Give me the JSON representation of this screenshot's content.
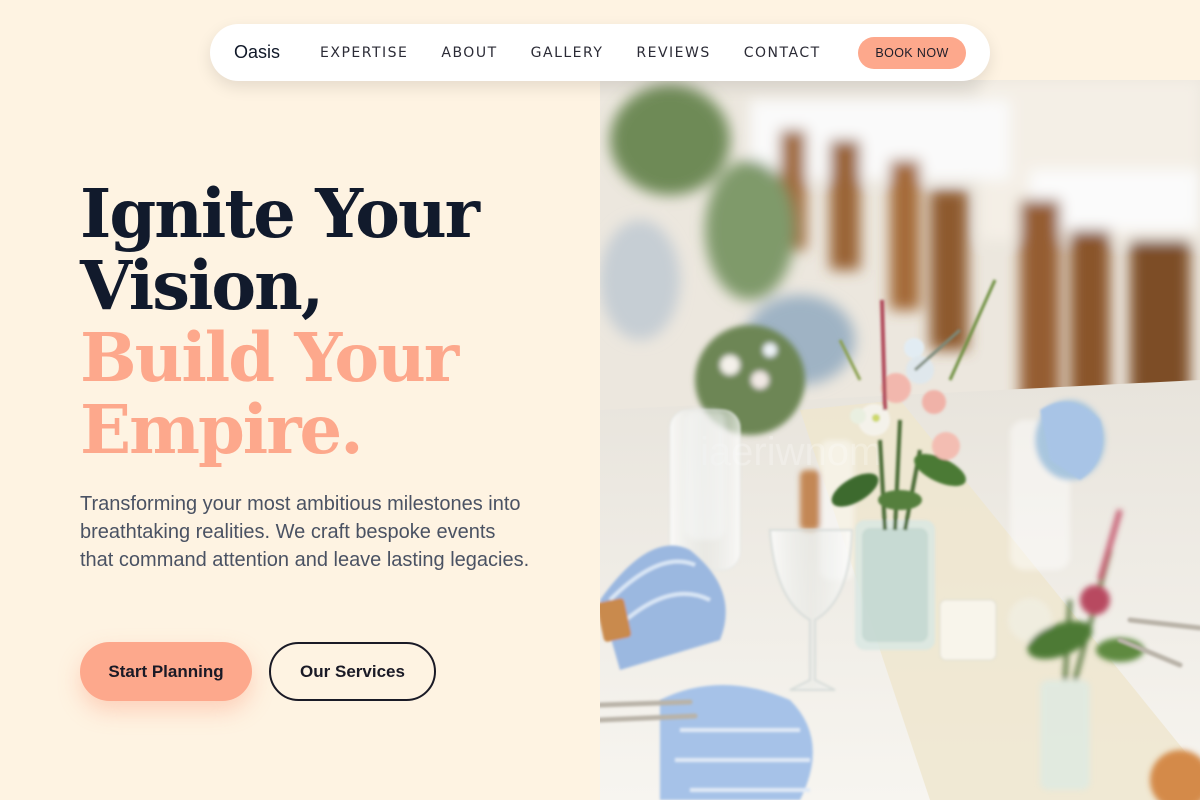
{
  "brand": {
    "name": "Oasis"
  },
  "nav": {
    "links": [
      "EXPERTISE",
      "ABOUT",
      "GALLERY",
      "REVIEWS",
      "CONTACT"
    ],
    "cta_label": "BOOK NOW"
  },
  "hero": {
    "headline_line1": "Ignite Your",
    "headline_line2": "Vision,",
    "headline_accent_line1": "Build Your",
    "headline_accent_line2": "Empire.",
    "subtitle": "Transforming your most ambitious milestones into breathtaking realities. We craft bespoke events that command attention and leave lasting legacies.",
    "primary_cta": "Start Planning",
    "secondary_cta": "Our Services",
    "image_icon": "wedding-table-photo"
  },
  "colors": {
    "background": "#fef3e2",
    "accent": "#fda88c",
    "heading": "#111a2c",
    "body_text": "#4a5263"
  }
}
